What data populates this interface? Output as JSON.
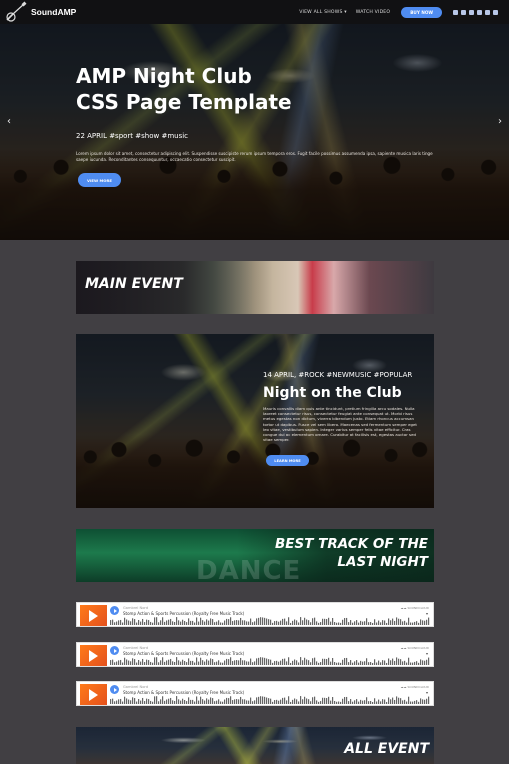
{
  "header": {
    "brand": "SoundAMP",
    "nav": [
      "VIEW ALL SHOWS ▾",
      "WATCH VIDEO"
    ],
    "cta": "BUY NOW",
    "socials": [
      "youtube-icon",
      "facebook-icon",
      "twitter-icon",
      "instagram-icon",
      "pinterest-icon",
      "vimeo-icon"
    ]
  },
  "hero": {
    "title_line1": "AMP Night Club",
    "title_line2": "CSS Page Template",
    "date_tags": "22 APRIL #sport #show #music",
    "description": "Lorem ipsum dolor sit amet, consectetur adipiscing elit. Suspendisse suscipiste rerum ipsum tempora eros. Fugit facile possimus assumenda ipsa, sapiente musica laris tinge saepe iucunda. Reconditantes consequuntur, occaecatio consectetur suscipit.",
    "button": "VIEW MORE",
    "prev_arrow": "‹",
    "next_arrow": "›"
  },
  "main_event": {
    "title": "MAIN EVENT"
  },
  "feature": {
    "tags": "14 APRIL, #ROCK #NEWMUSIC #POPULAR",
    "title": "Night on the Club",
    "description": "Mauris convallis diam quis ante tincidunt, pretium fringilla arcu sodales. Nulla laoreet consectetur risus, consectetur feugiat ante consequat ut. Morbi risus metus egestas non dictum, viverra bibendum justo. Etiam rhoncus accumsan tortor ut dapibus. Fusce vel sem libero. Maecenas sed fermentum semper eget leo vitae, vestibulum sapien. Integer varius semper felis vitae efficitur. Cras congue dui ac elementum ornare. Curabitur at facilisis est, egestas auctor sed vitae semper.",
    "button": "LEARN MORE"
  },
  "best_track": {
    "title_line1": "BEST TRACK OF THE",
    "title_line2": "LAST NIGHT",
    "background_word": "DANCE"
  },
  "players": [
    {
      "artist": "Gambrel Nord",
      "track": "Stomp Action & Sports Percussion (Royalty Free Music Track)",
      "brand": "☁☁ SOUNDCLOUD",
      "menu": "▾"
    },
    {
      "artist": "Gambrel Nord",
      "track": "Stomp Action & Sports Percussion (Royalty Free Music Track)",
      "brand": "☁☁ SOUNDCLOUD",
      "menu": "▾"
    },
    {
      "artist": "Gambrel Nord",
      "track": "Stomp Action & Sports Percussion (Royalty Free Music Track)",
      "brand": "☁☁ SOUNDCLOUD",
      "menu": "▾"
    }
  ],
  "all_event": {
    "title": "ALL EVENT"
  },
  "colors": {
    "accent": "#4f8cf1",
    "page_bg": "#413f43",
    "soundcloud_orange": "#ff7a1a"
  }
}
